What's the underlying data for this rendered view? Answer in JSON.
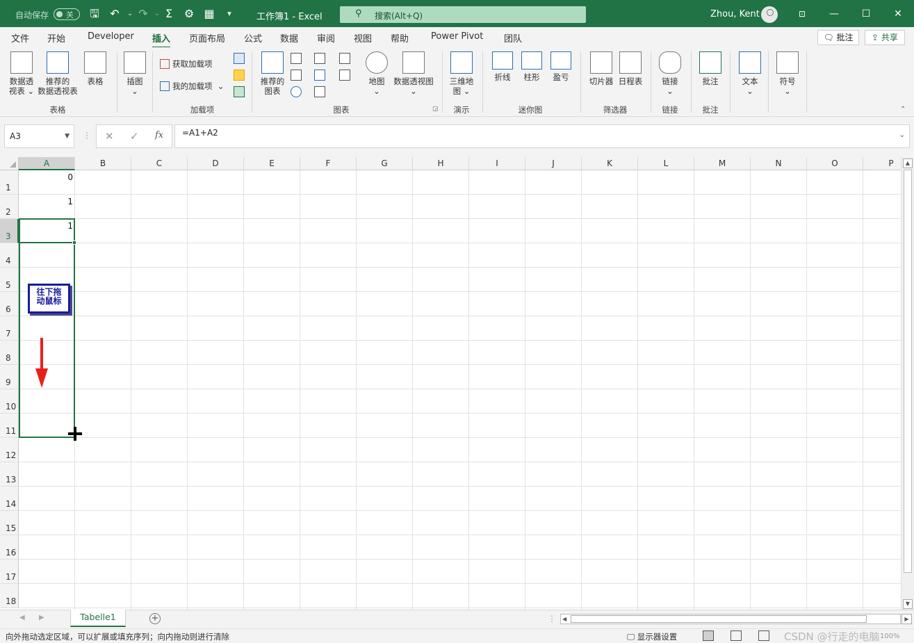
{
  "titlebar": {
    "autosave_label": "自动保存",
    "autosave_state": "关",
    "doc_title": "工作簿1  -  Excel",
    "search_placeholder": "搜索(Alt+Q)",
    "user_name": "Zhou, Kent",
    "icons": [
      "save-icon",
      "undo-icon",
      "redo-icon",
      "sigma-icon",
      "formula-check-icon",
      "table-icon",
      "customize-qat-icon"
    ]
  },
  "tabs": [
    "文件",
    "开始",
    "Developer",
    "插入",
    "页面布局",
    "公式",
    "数据",
    "审阅",
    "视图",
    "帮助",
    "Power Pivot",
    "团队"
  ],
  "active_tab": "插入",
  "tab_actions": {
    "comment": "批注",
    "share": "共享"
  },
  "ribbon": {
    "tables": {
      "pivot": "数据透\n视表",
      "pivot_line2": "视表 ⌄",
      "pivot_line1": "数据透",
      "rec_pivot1": "推荐的",
      "rec_pivot2": "数据透视表",
      "table": "表格",
      "group": "表格"
    },
    "illustrations": {
      "label": "插图"
    },
    "addins": {
      "get": "获取加载项",
      "mine": "我的加载项",
      "group": "加载项"
    },
    "charts": {
      "rec1": "推荐的",
      "rec2": "图表",
      "map": "地图",
      "pivotchart": "数据透视图",
      "group": "图表"
    },
    "tours": {
      "map3d1": "三维地",
      "map3d2": "图 ⌄",
      "group": "演示"
    },
    "sparklines": {
      "line": "折线",
      "column": "柱形",
      "winloss": "盈亏",
      "group": "迷你图"
    },
    "filters": {
      "slicer": "切片器",
      "timeline": "日程表",
      "group": "筛选器"
    },
    "links": {
      "link": "链接",
      "group": "链接"
    },
    "comments": {
      "comment": "批注",
      "group": "批注"
    },
    "text": {
      "text": "文本"
    },
    "symbols": {
      "symbol": "符号"
    }
  },
  "formula_bar": {
    "name_box": "A3",
    "formula": "=A1+A2",
    "fx_label": "fx"
  },
  "grid": {
    "columns": [
      "A",
      "B",
      "C",
      "D",
      "E",
      "F",
      "G",
      "H",
      "I",
      "J",
      "K",
      "L",
      "M",
      "N",
      "O",
      "P"
    ],
    "rows": [
      "1",
      "2",
      "3",
      "4",
      "5",
      "6",
      "7",
      "8",
      "9",
      "10",
      "11",
      "12",
      "13",
      "14",
      "15",
      "16",
      "17",
      "18"
    ],
    "selected_column": "A",
    "selected_row": "3",
    "cells": {
      "A1": "0",
      "A2": "1",
      "A3": "1"
    }
  },
  "annotation": {
    "text": "往下拖动鼠标",
    "line1": "往下拖",
    "line2": "动鼠标",
    "arrow_color": "#e8201c"
  },
  "sheets": {
    "active": "Tabelle1"
  },
  "statusbar": {
    "message": "向外拖动选定区域，可以扩展或填充序列；向内拖动则进行清除",
    "display_settings": "显示器设置",
    "zoom": "100%",
    "watermark": "CSDN @行走的电脑"
  },
  "colors": {
    "brand": "#217346",
    "search_bg": "#aedbc0"
  }
}
